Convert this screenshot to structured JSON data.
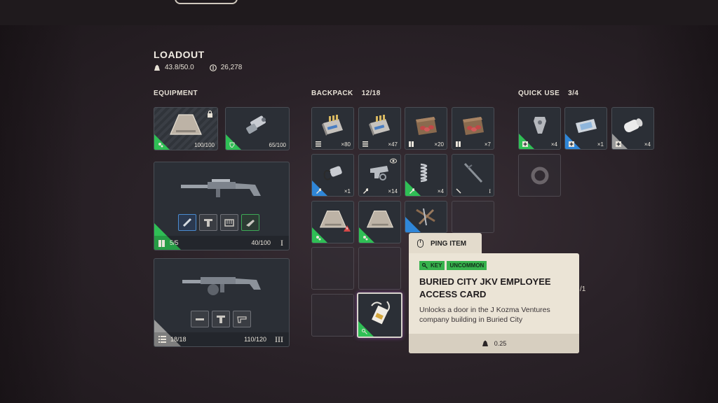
{
  "header": {
    "title": "LOADOUT",
    "weight": "43.8/50.0",
    "currency": "26,278"
  },
  "sections": {
    "equipment": {
      "label": "EQUIPMENT"
    },
    "backpack": {
      "label": "BACKPACK",
      "count": "12/18"
    },
    "quick_use": {
      "label": "QUICK USE",
      "count": "3/4"
    }
  },
  "equipment": {
    "augment": {
      "value": "100/100",
      "icon": "augment-icon"
    },
    "shield": {
      "value": "65/100",
      "icon": "shield-icon"
    },
    "weapon1": {
      "ammo": "5/5",
      "durability": "40/100",
      "tier": "I"
    },
    "weapon2": {
      "ammo": "18/18",
      "durability": "110/120",
      "tier": "III"
    }
  },
  "backpack": {
    "items": [
      {
        "qty": "×80",
        "rarity": "grey"
      },
      {
        "qty": "×47",
        "rarity": "grey"
      },
      {
        "qty": "×20",
        "rarity": "grey"
      },
      {
        "qty": "×7",
        "rarity": "grey"
      },
      {
        "qty": "×1",
        "rarity": "blue"
      },
      {
        "qty": "×14",
        "rarity": "grey"
      },
      {
        "qty": "×4",
        "rarity": "green"
      },
      {
        "qty": "I",
        "rarity": "grey"
      },
      {
        "qty": "",
        "rarity": "green"
      },
      {
        "qty": "",
        "rarity": "green"
      },
      {
        "qty": "",
        "rarity": "blue"
      }
    ]
  },
  "quick_use": {
    "items": [
      {
        "qty": "×4",
        "rarity": "green"
      },
      {
        "qty": "×1",
        "rarity": "blue"
      },
      {
        "qty": "×4",
        "rarity": "grey"
      }
    ]
  },
  "tooltip": {
    "ping_label": "PING ITEM",
    "tag_type": "KEY",
    "tag_rarity": "UNCOMMON",
    "title": "BURIED CITY JKV EMPLOYEE ACCESS CARD",
    "description": "Unlocks a door in the J Kozma Ventures company building in Buried City",
    "weight": "0.25",
    "partial_text": "/1"
  },
  "colors": {
    "uncommon": "#37b24d",
    "rare": "#2f86d8",
    "common": "#9a9a9a",
    "tooltip_bg": "#ebe4d6"
  }
}
